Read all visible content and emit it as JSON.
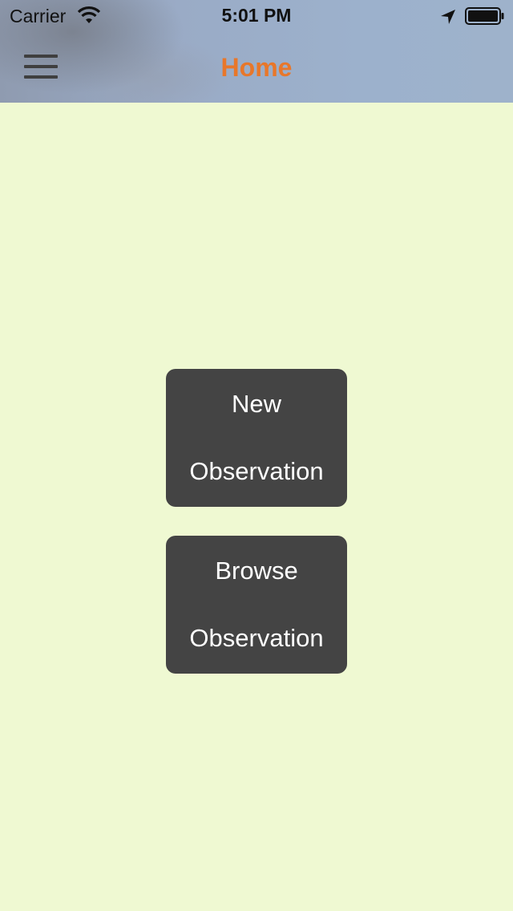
{
  "status_bar": {
    "carrier": "Carrier",
    "time": "5:01 PM",
    "icons": [
      "wifi-icon",
      "location-arrow-icon",
      "battery-icon"
    ]
  },
  "nav": {
    "title": "Home",
    "title_color": "#e8772a",
    "menu_icon": "hamburger-menu-icon"
  },
  "actions": {
    "new_line1": "New",
    "new_line2": "Observation",
    "browse_line1": "Browse",
    "browse_line2": "Observation"
  },
  "colors": {
    "background": "#eff9d2",
    "button": "#444444",
    "button_text": "#ffffff"
  }
}
